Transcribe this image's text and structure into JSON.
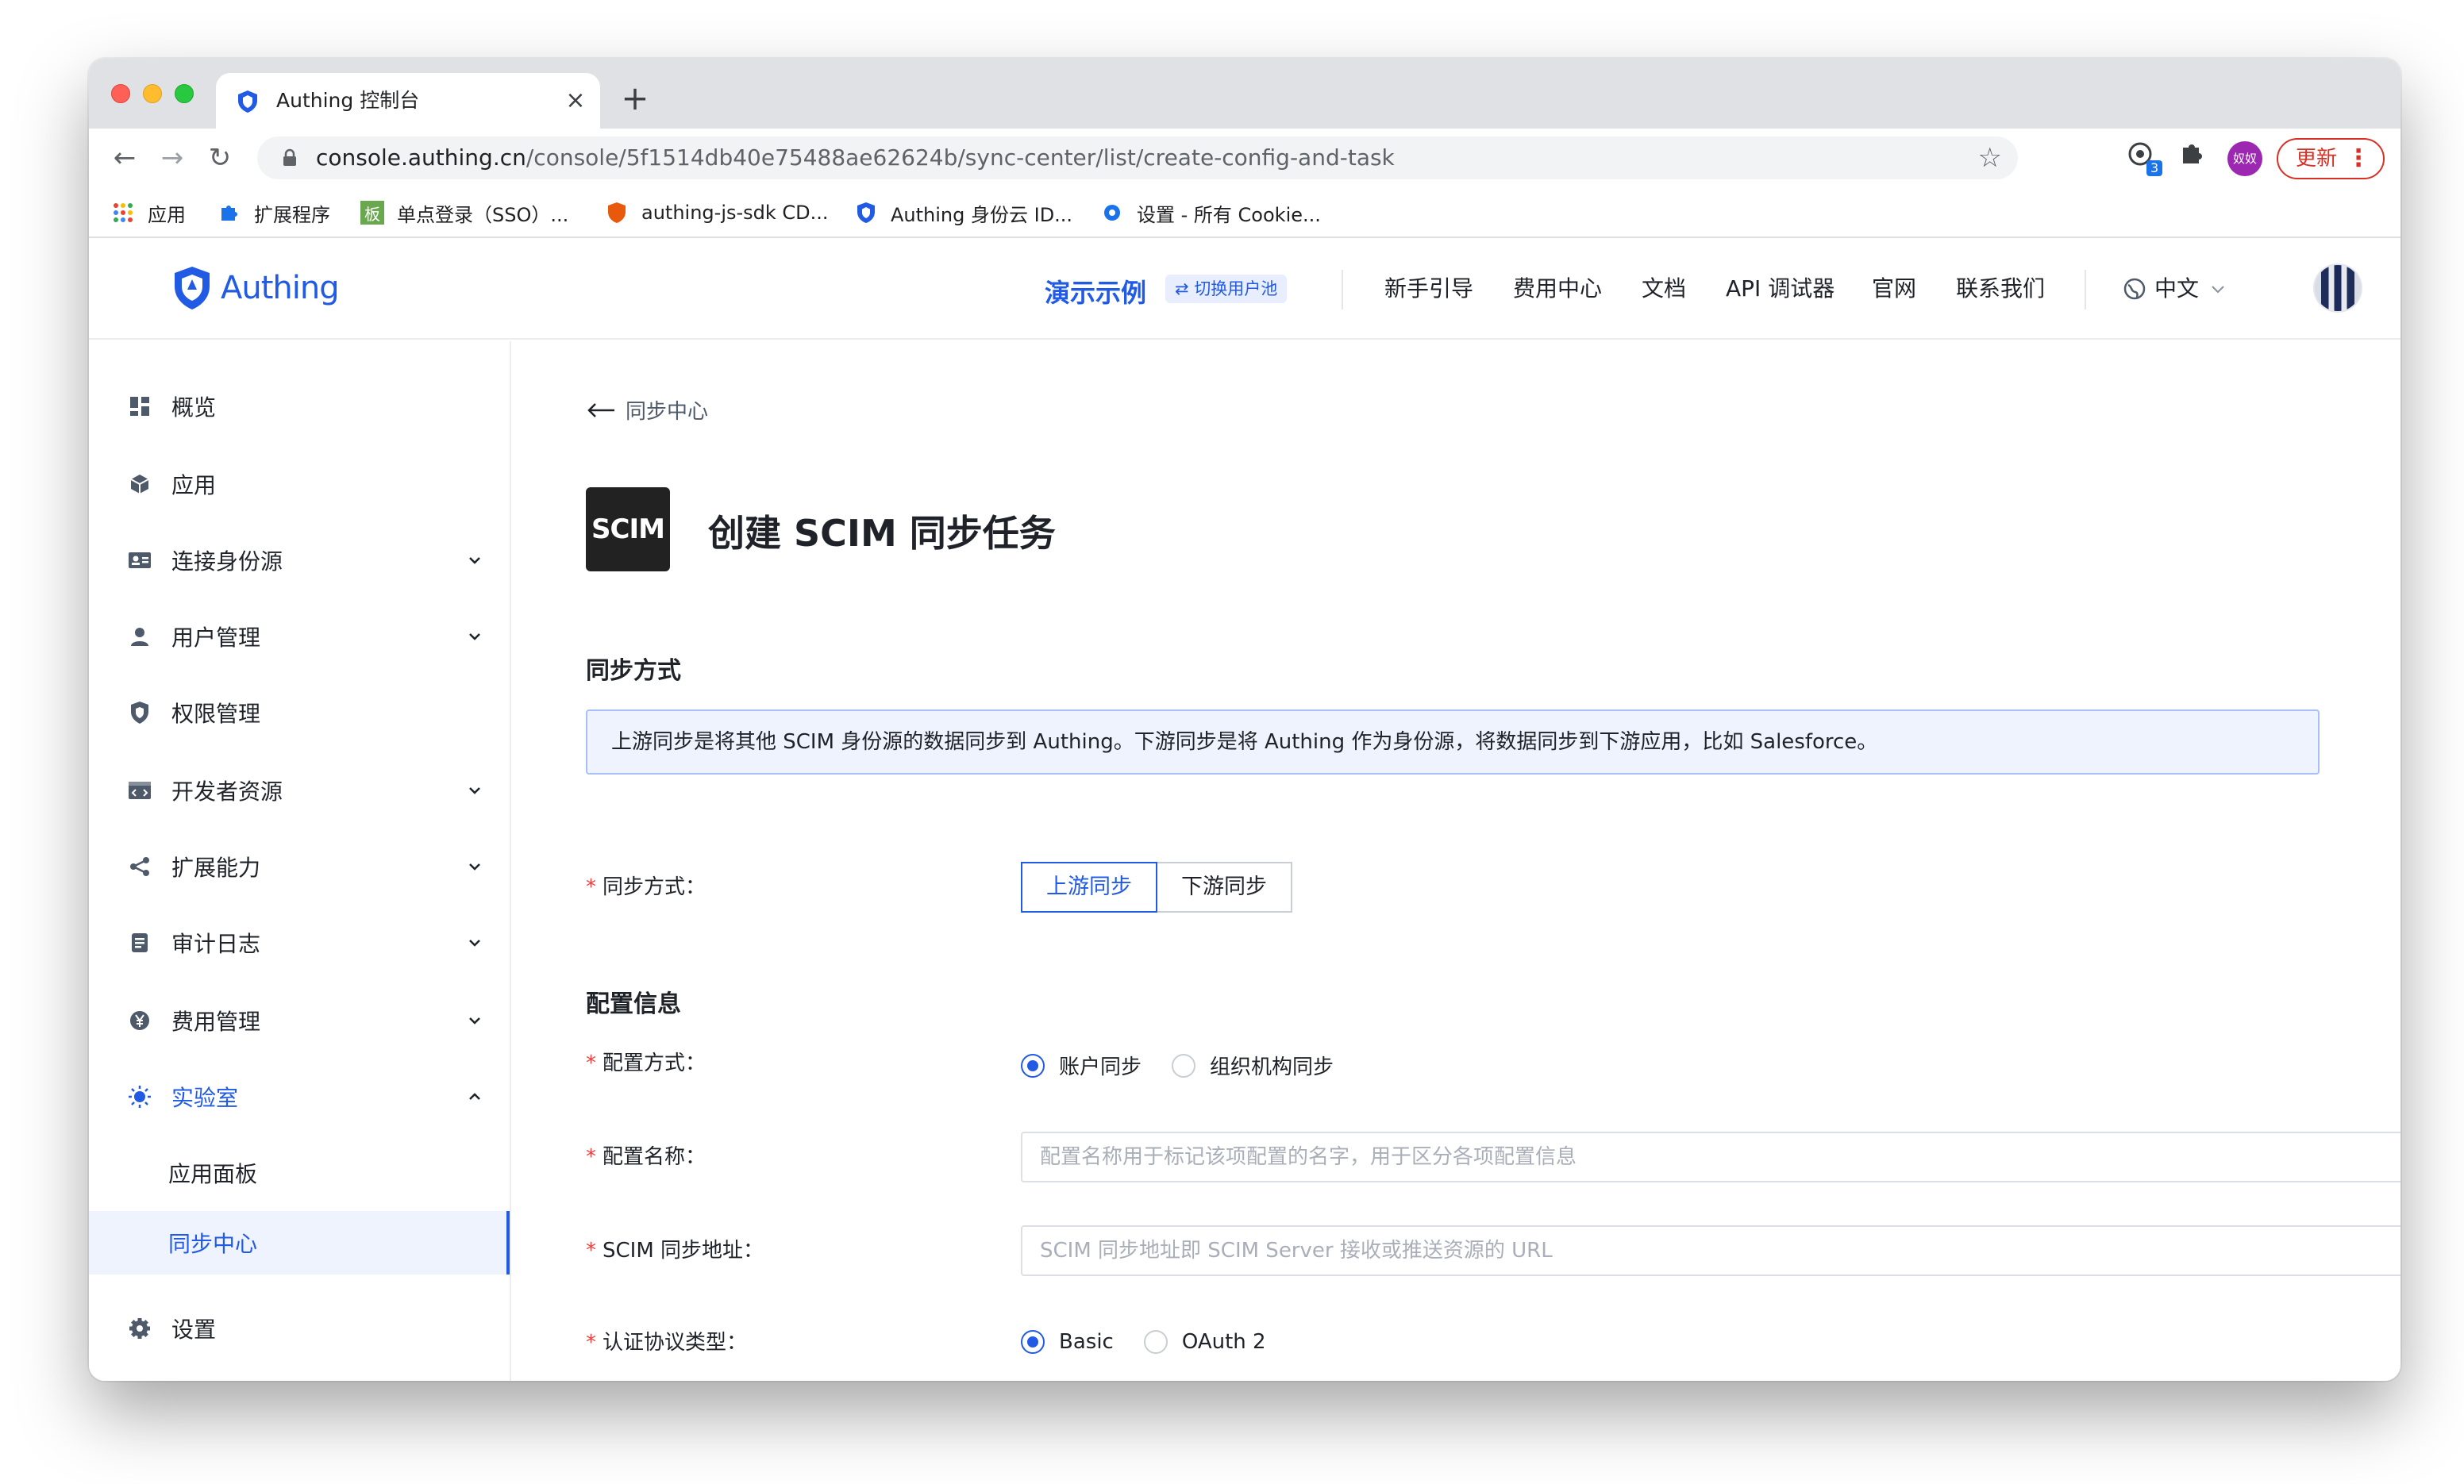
{
  "browser": {
    "tab_title": "Authing 控制台",
    "tab_close": "×",
    "new_tab": "+",
    "url_host": "console.authing.cn",
    "url_path": "/console/5f1514db40e75488ae62624b/sync-center/list/create-config-and-task",
    "ext_badge": "3",
    "profile_initials": "奴奴",
    "update_label": "更新",
    "bookmarks": [
      "应用",
      "扩展程序",
      "单点登录（SSO）...",
      "authing-js-sdk CD...",
      "Authing 身份云 ID...",
      "设置 - 所有 Cookie..."
    ]
  },
  "header": {
    "logo_text": "Authing",
    "demo_label": "演示示例",
    "switch_pool": "⇄ 切换用户池",
    "nav": [
      "新手引导",
      "费用中心",
      "文档",
      "API 调试器",
      "官网",
      "联系我们"
    ],
    "lang": "中文"
  },
  "sidebar": {
    "items": [
      {
        "label": "概览",
        "icon": "dashboard-icon",
        "expandable": false
      },
      {
        "label": "应用",
        "icon": "cube-icon",
        "expandable": false
      },
      {
        "label": "连接身份源",
        "icon": "id-card-icon",
        "expandable": true
      },
      {
        "label": "用户管理",
        "icon": "user-icon",
        "expandable": true
      },
      {
        "label": "权限管理",
        "icon": "shield-icon",
        "expandable": false
      },
      {
        "label": "开发者资源",
        "icon": "code-icon",
        "expandable": true
      },
      {
        "label": "扩展能力",
        "icon": "share-icon",
        "expandable": true
      },
      {
        "label": "审计日志",
        "icon": "log-icon",
        "expandable": true
      },
      {
        "label": "费用管理",
        "icon": "yen-icon",
        "expandable": true
      },
      {
        "label": "实验室",
        "icon": "bulb-icon",
        "expandable": true,
        "expanded": true
      }
    ],
    "sub_items": [
      "应用面板",
      "同步中心"
    ],
    "settings": "设置"
  },
  "main": {
    "back_label": "同步中心",
    "logo_text": "SCIM",
    "title": "创建 SCIM 同步任务",
    "section_sync": "同步方式",
    "info": "上游同步是将其他 SCIM 身份源的数据同步到 Authing。下游同步是将 Authing 作为身份源，将数据同步到下游应用，比如 Salesforce。",
    "sync_label": "同步方式：",
    "sync_options": [
      "上游同步",
      "下游同步"
    ],
    "section_config": "配置信息",
    "config_mode_label": "配置方式：",
    "config_mode_options": [
      "账户同步",
      "组织机构同步"
    ],
    "config_name_label": "配置名称：",
    "config_name_placeholder": "配置名称用于标记该项配置的名字，用于区分各项配置信息",
    "scim_url_label": "SCIM 同步地址：",
    "scim_url_placeholder": "SCIM 同步地址即 SCIM Server 接收或推送资源的 URL",
    "auth_type_label": "认证协议类型：",
    "auth_type_options": [
      "Basic",
      "OAuth 2"
    ]
  },
  "colors": {
    "accent": "#215ae5",
    "required": "#f53f3f",
    "selected_bg": "#eef3fe"
  }
}
